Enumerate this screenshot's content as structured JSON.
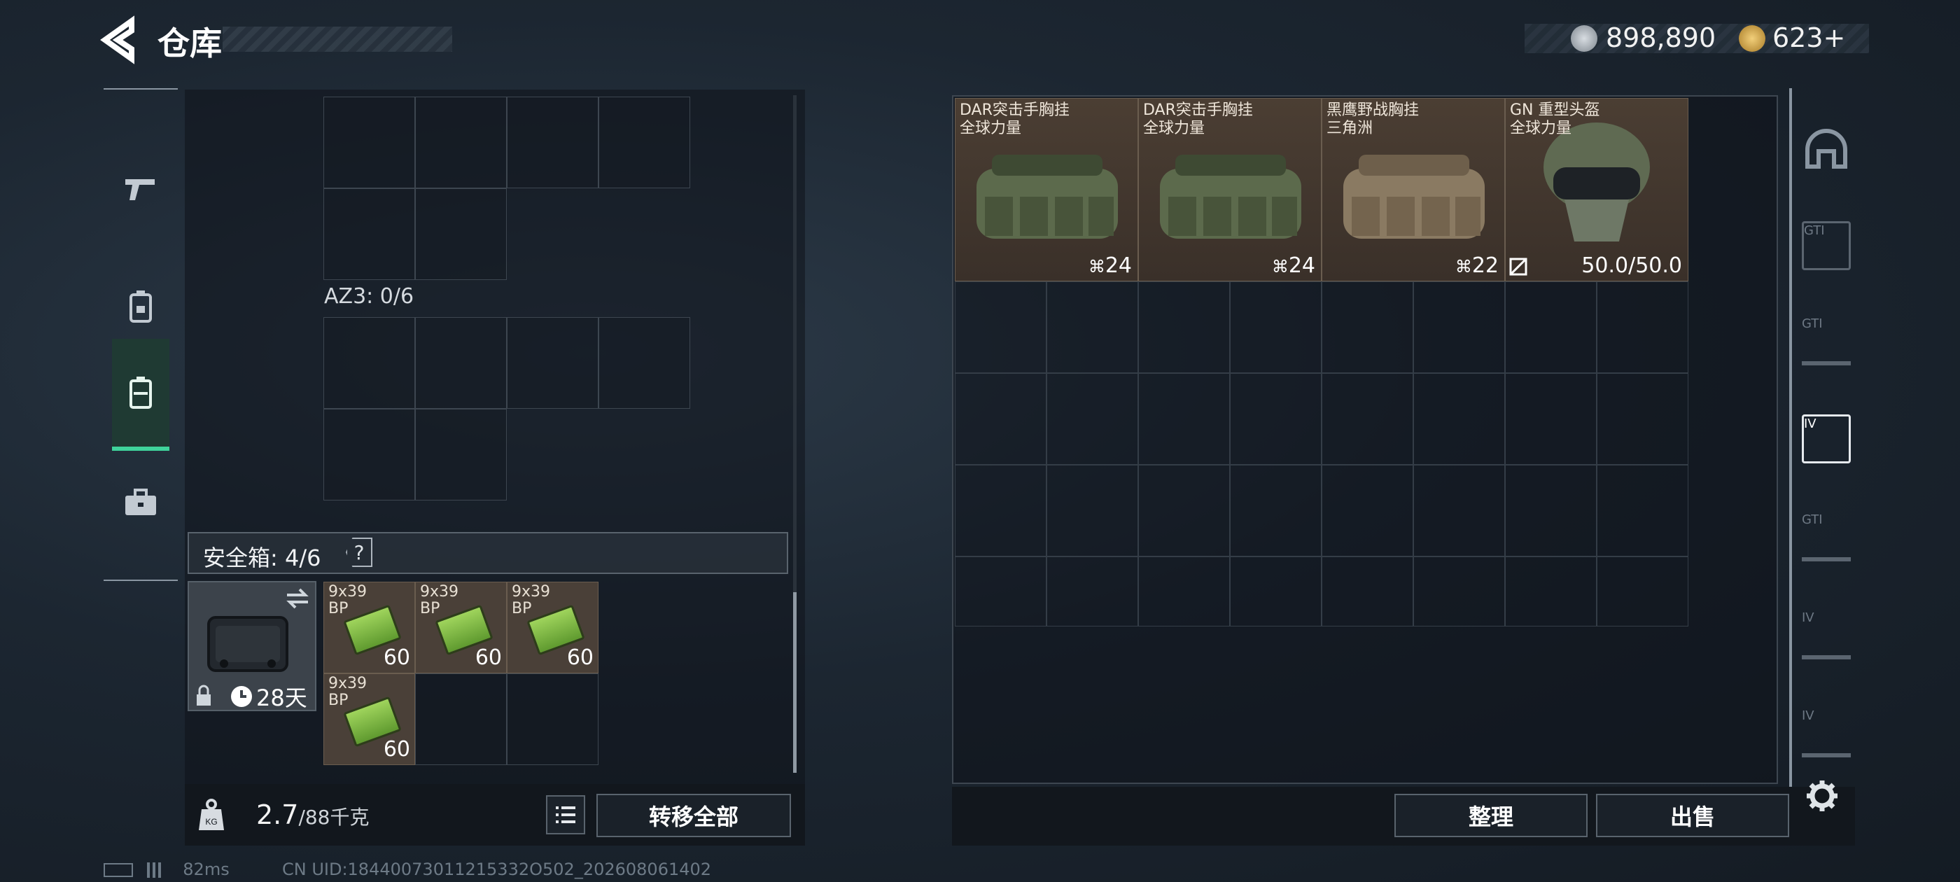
{
  "header": {
    "title": "仓库"
  },
  "currencies": [
    {
      "name": "silver-coin-icon",
      "value": "898,890"
    },
    {
      "name": "gold-coin-icon",
      "value": "623+"
    }
  ],
  "sidebar": {
    "tabs": [
      {
        "icon": "pistol-icon"
      },
      {
        "icon": "backpack-lock-icon"
      },
      {
        "icon": "backpack-icon",
        "active": true
      },
      {
        "icon": "briefcase-icon"
      }
    ]
  },
  "left": {
    "container_label": "AZ3: 0/6",
    "safebox": {
      "title": "安全箱: 4/6",
      "help": "?",
      "timer": "28天"
    },
    "ammo": [
      {
        "label": "9x39\nBP",
        "qty": "60"
      },
      {
        "label": "9x39\nBP",
        "qty": "60"
      },
      {
        "label": "9x39\nBP",
        "qty": "60"
      },
      {
        "label": "9x39\nBP",
        "qty": "60"
      }
    ],
    "weight": {
      "current": "2.7",
      "max": "/88千克"
    },
    "transfer_all": "转移全部"
  },
  "right": {
    "items": [
      {
        "name": "DAR突击手胸挂",
        "sub": "全球力量",
        "count": "24",
        "color": "#5c6a4c"
      },
      {
        "name": "DAR突击手胸挂",
        "sub": "全球力量",
        "count": "24",
        "color": "#5c6a4c"
      },
      {
        "name": "黑鹰野战胸挂",
        "sub": "三角洲",
        "count": "22",
        "color": "#8a7a62"
      },
      {
        "name": "GN 重型头盔",
        "sub": "全球力量",
        "count": "50.0/50.0",
        "color": "#5f6a52"
      }
    ],
    "buttons": {
      "organize": "整理",
      "sell": "出售"
    },
    "rail": [
      "helmet-icon",
      "GTI",
      "GTI",
      "IV",
      "GTI",
      "IV",
      "IV"
    ]
  },
  "status": {
    "ping": "82ms",
    "uid": "CN UID:18440073011215332O502_202608061402"
  }
}
